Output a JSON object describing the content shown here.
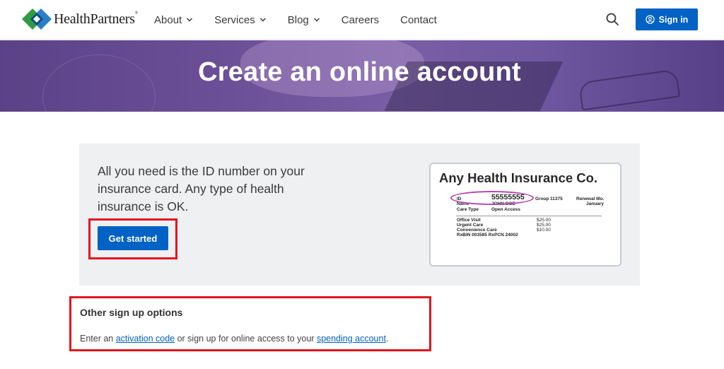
{
  "header": {
    "logo_text": "HealthPartners",
    "logo_mark": "®",
    "nav": [
      {
        "label": "About",
        "has_dropdown": true
      },
      {
        "label": "Services",
        "has_dropdown": true
      },
      {
        "label": "Blog",
        "has_dropdown": true
      },
      {
        "label": "Careers",
        "has_dropdown": false
      },
      {
        "label": "Contact",
        "has_dropdown": false
      }
    ],
    "search_icon": "search-icon",
    "signin_label": "Sign in",
    "accent_color": "#0062c4"
  },
  "hero": {
    "title": "Create an online account"
  },
  "main": {
    "intro": "All you need is the ID number on your insurance card. Any type of health insurance is OK.",
    "get_started_label": "Get started",
    "card": {
      "title": "Any Health Insurance Co.",
      "id_label": "ID",
      "id_value": "55555555",
      "group_label": "Group",
      "group_value": "11375",
      "renewal_label": "Renewal Mo.",
      "renewal_value": "January",
      "name_label": "Name",
      "name_value": "JOHN DOE",
      "care_type_label": "Care Type",
      "care_type_value": "Open Access",
      "benefits": [
        {
          "label": "Office Visit",
          "value": "$25.00"
        },
        {
          "label": "Urgent Care",
          "value": "$25.00"
        },
        {
          "label": "Convenience Care",
          "value": "$10.00"
        }
      ],
      "rx_line": "RxBIN 003585 RxPCN 24002"
    }
  },
  "other": {
    "title": "Other sign up options",
    "text_prefix": "Enter an ",
    "activation_link": "activation code",
    "text_middle": " or sign up for online access to your ",
    "spending_link": "spending account",
    "text_suffix": "."
  },
  "colors": {
    "highlight": "#e3141d",
    "ellipse": "#b544b6"
  }
}
